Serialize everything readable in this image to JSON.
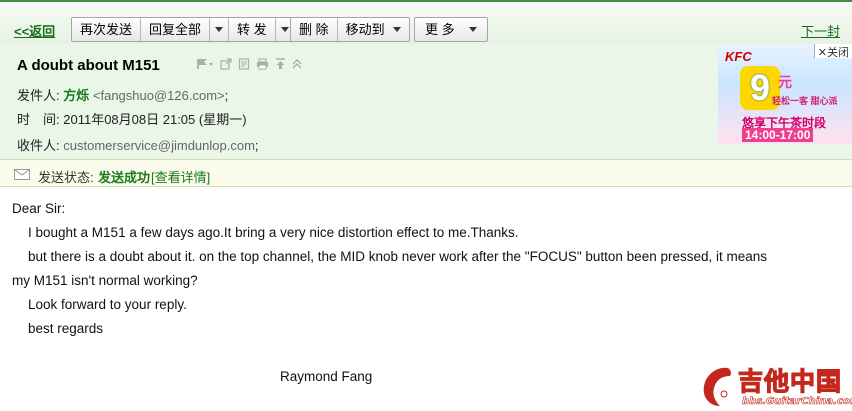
{
  "toolbar": {
    "back_label": "<<返回",
    "resend_label": "再次发送",
    "reply_all_label": "回复全部",
    "forward_label": "转 发",
    "delete_label": "删 除",
    "move_to_label": "移动到",
    "more_label": "更 多",
    "next_label": "下一封"
  },
  "email": {
    "subject": "A doubt about M151",
    "sender_label": "发件人:",
    "sender_name": "方烁",
    "sender_email": "<fangshuo@126.com>",
    "sender_sep": ";",
    "time_label": "时　间:",
    "time_value": "2011年08月08日 21:05 (星期一)",
    "recipient_label": "收件人:",
    "recipient_email": "customerservice@jimdunlop.com",
    "recipient_sep": ";"
  },
  "status": {
    "label": "发送状态:",
    "value": "发送成功",
    "detail": "[查看详情]"
  },
  "body": {
    "greeting": "Dear Sir:",
    "line1": "I bought a M151 a few days ago.It bring a very nice distortion effect to me.Thanks.",
    "line2a": "but there is a doubt about it. on the top channel, the MID knob never work after the \"FOCUS\" button been pressed, it means",
    "line2b": "my M151 isn't normal working?",
    "line3": "Look forward to your reply.",
    "line4": "best regards",
    "signature": "Raymond Fang"
  },
  "ad": {
    "close_label": "关闭",
    "brand": "KFC",
    "big_number": "9",
    "currency": "元",
    "tagline": "轻松一客 甜心派",
    "line1": "悠享下午茶时段",
    "line2": "14:00-17:00"
  },
  "watermark": {
    "name": "吉他中国",
    "url": "bbs.GuitarChina.com"
  },
  "colors": {
    "green_accent": "#1a7a1a",
    "header_bg": "#eaf6e8",
    "status_bg": "#fafbea"
  }
}
